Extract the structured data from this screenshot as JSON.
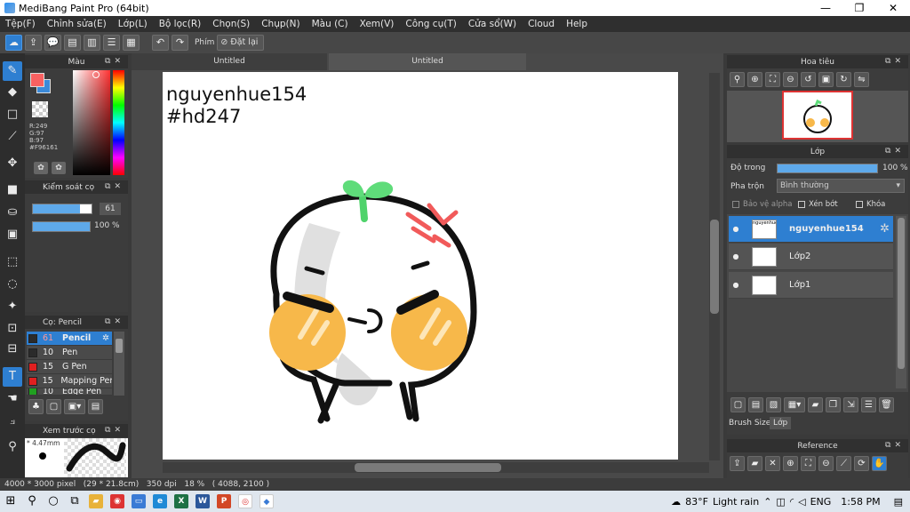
{
  "window": {
    "title": "MediBang Paint Pro (64bit)",
    "min": "—",
    "max": "❐",
    "close": "✕"
  },
  "menu": [
    "Tệp(F)",
    "Chỉnh sửa(E)",
    "Lớp(L)",
    "Bộ lọc(R)",
    "Chọn(S)",
    "Chụp(N)",
    "Màu (C)",
    "Xem(V)",
    "Công cụ(T)",
    "Cửa sổ(W)",
    "Cloud",
    "Help"
  ],
  "toolbar": {
    "shortcut_label": "Phím",
    "undo_all_label": "Đặt lại"
  },
  "color_panel": {
    "title": "Màu",
    "main_color": "#F96161",
    "readout": {
      "r": "R:249",
      "g": "G:97",
      "b": "B:97",
      "hex": "#F96161"
    }
  },
  "brush_control": {
    "title": "Kiểm soát cọ",
    "size_value": "61",
    "opacity_value": "100 %",
    "size_fraction": 0.8,
    "opacity_fraction": 1.0
  },
  "brush_list": {
    "title": "Cọ: Pencil",
    "items": [
      {
        "size": "61",
        "name": "Pencil",
        "color": "#2b2b2b"
      },
      {
        "size": "10",
        "name": "Pen",
        "color": "#2b2b2b"
      },
      {
        "size": "15",
        "name": "G Pen",
        "color": "#e02020"
      },
      {
        "size": "15",
        "name": "Mapping Pen",
        "color": "#e02020"
      },
      {
        "size": "10",
        "name": "Edge Pen",
        "color": "#20a020"
      }
    ]
  },
  "brush_preview": {
    "title": "Xem trước cọ",
    "size_label": "* 4.47mm"
  },
  "canvas": {
    "tab1": "Untitled",
    "tab2": "Untitled",
    "text_line1": "nguyenhue154",
    "text_line2": "#hd247"
  },
  "navigator": {
    "title": "Hoa tiêu"
  },
  "layer_panel": {
    "title": "Lớp",
    "opacity_label": "Độ trong",
    "opacity_value": "100 %",
    "opacity_fraction": 1.0,
    "blend_label": "Pha trộn",
    "blend_value": "Bình thường",
    "protect_alpha": "Bảo vệ alpha",
    "clipping": "Xén bớt",
    "lock": "Khóa",
    "layers": [
      {
        "name": "nguyenhue154",
        "selected": true
      },
      {
        "name": "Lớp2",
        "selected": false
      },
      {
        "name": "Lớp1",
        "selected": false
      }
    ],
    "footer_tab1": "Brush Size",
    "footer_tab2": "Lớp"
  },
  "reference": {
    "title": "Reference"
  },
  "status": {
    "text": "4000 * 3000 pixel   (29 * 21.8cm)   350 dpi   18 %   ( 4088, 2100 )"
  },
  "taskbar": {
    "weather_temp": "83°F",
    "weather_text": "Light rain",
    "lang": "ENG",
    "time": "1:58 PM"
  }
}
